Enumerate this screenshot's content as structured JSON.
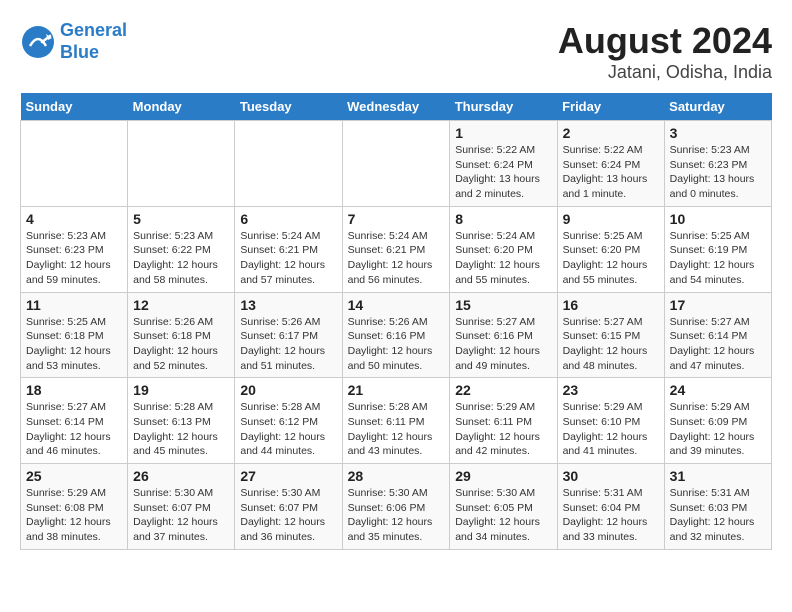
{
  "header": {
    "logo_line1": "General",
    "logo_line2": "Blue",
    "month": "August 2024",
    "location": "Jatani, Odisha, India"
  },
  "weekdays": [
    "Sunday",
    "Monday",
    "Tuesday",
    "Wednesday",
    "Thursday",
    "Friday",
    "Saturday"
  ],
  "weeks": [
    [
      {
        "day": "",
        "info": ""
      },
      {
        "day": "",
        "info": ""
      },
      {
        "day": "",
        "info": ""
      },
      {
        "day": "",
        "info": ""
      },
      {
        "day": "1",
        "info": "Sunrise: 5:22 AM\nSunset: 6:24 PM\nDaylight: 13 hours\nand 2 minutes."
      },
      {
        "day": "2",
        "info": "Sunrise: 5:22 AM\nSunset: 6:24 PM\nDaylight: 13 hours\nand 1 minute."
      },
      {
        "day": "3",
        "info": "Sunrise: 5:23 AM\nSunset: 6:23 PM\nDaylight: 13 hours\nand 0 minutes."
      }
    ],
    [
      {
        "day": "4",
        "info": "Sunrise: 5:23 AM\nSunset: 6:23 PM\nDaylight: 12 hours\nand 59 minutes."
      },
      {
        "day": "5",
        "info": "Sunrise: 5:23 AM\nSunset: 6:22 PM\nDaylight: 12 hours\nand 58 minutes."
      },
      {
        "day": "6",
        "info": "Sunrise: 5:24 AM\nSunset: 6:21 PM\nDaylight: 12 hours\nand 57 minutes."
      },
      {
        "day": "7",
        "info": "Sunrise: 5:24 AM\nSunset: 6:21 PM\nDaylight: 12 hours\nand 56 minutes."
      },
      {
        "day": "8",
        "info": "Sunrise: 5:24 AM\nSunset: 6:20 PM\nDaylight: 12 hours\nand 55 minutes."
      },
      {
        "day": "9",
        "info": "Sunrise: 5:25 AM\nSunset: 6:20 PM\nDaylight: 12 hours\nand 55 minutes."
      },
      {
        "day": "10",
        "info": "Sunrise: 5:25 AM\nSunset: 6:19 PM\nDaylight: 12 hours\nand 54 minutes."
      }
    ],
    [
      {
        "day": "11",
        "info": "Sunrise: 5:25 AM\nSunset: 6:18 PM\nDaylight: 12 hours\nand 53 minutes."
      },
      {
        "day": "12",
        "info": "Sunrise: 5:26 AM\nSunset: 6:18 PM\nDaylight: 12 hours\nand 52 minutes."
      },
      {
        "day": "13",
        "info": "Sunrise: 5:26 AM\nSunset: 6:17 PM\nDaylight: 12 hours\nand 51 minutes."
      },
      {
        "day": "14",
        "info": "Sunrise: 5:26 AM\nSunset: 6:16 PM\nDaylight: 12 hours\nand 50 minutes."
      },
      {
        "day": "15",
        "info": "Sunrise: 5:27 AM\nSunset: 6:16 PM\nDaylight: 12 hours\nand 49 minutes."
      },
      {
        "day": "16",
        "info": "Sunrise: 5:27 AM\nSunset: 6:15 PM\nDaylight: 12 hours\nand 48 minutes."
      },
      {
        "day": "17",
        "info": "Sunrise: 5:27 AM\nSunset: 6:14 PM\nDaylight: 12 hours\nand 47 minutes."
      }
    ],
    [
      {
        "day": "18",
        "info": "Sunrise: 5:27 AM\nSunset: 6:14 PM\nDaylight: 12 hours\nand 46 minutes."
      },
      {
        "day": "19",
        "info": "Sunrise: 5:28 AM\nSunset: 6:13 PM\nDaylight: 12 hours\nand 45 minutes."
      },
      {
        "day": "20",
        "info": "Sunrise: 5:28 AM\nSunset: 6:12 PM\nDaylight: 12 hours\nand 44 minutes."
      },
      {
        "day": "21",
        "info": "Sunrise: 5:28 AM\nSunset: 6:11 PM\nDaylight: 12 hours\nand 43 minutes."
      },
      {
        "day": "22",
        "info": "Sunrise: 5:29 AM\nSunset: 6:11 PM\nDaylight: 12 hours\nand 42 minutes."
      },
      {
        "day": "23",
        "info": "Sunrise: 5:29 AM\nSunset: 6:10 PM\nDaylight: 12 hours\nand 41 minutes."
      },
      {
        "day": "24",
        "info": "Sunrise: 5:29 AM\nSunset: 6:09 PM\nDaylight: 12 hours\nand 39 minutes."
      }
    ],
    [
      {
        "day": "25",
        "info": "Sunrise: 5:29 AM\nSunset: 6:08 PM\nDaylight: 12 hours\nand 38 minutes."
      },
      {
        "day": "26",
        "info": "Sunrise: 5:30 AM\nSunset: 6:07 PM\nDaylight: 12 hours\nand 37 minutes."
      },
      {
        "day": "27",
        "info": "Sunrise: 5:30 AM\nSunset: 6:07 PM\nDaylight: 12 hours\nand 36 minutes."
      },
      {
        "day": "28",
        "info": "Sunrise: 5:30 AM\nSunset: 6:06 PM\nDaylight: 12 hours\nand 35 minutes."
      },
      {
        "day": "29",
        "info": "Sunrise: 5:30 AM\nSunset: 6:05 PM\nDaylight: 12 hours\nand 34 minutes."
      },
      {
        "day": "30",
        "info": "Sunrise: 5:31 AM\nSunset: 6:04 PM\nDaylight: 12 hours\nand 33 minutes."
      },
      {
        "day": "31",
        "info": "Sunrise: 5:31 AM\nSunset: 6:03 PM\nDaylight: 12 hours\nand 32 minutes."
      }
    ]
  ]
}
